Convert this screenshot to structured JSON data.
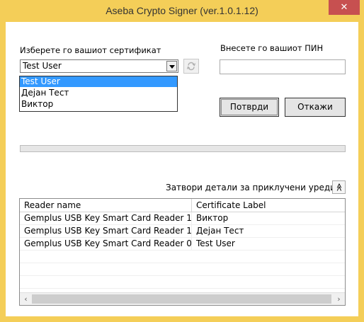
{
  "window": {
    "title": "Aseba Crypto Signer (ver.1.0.1.12)",
    "close_glyph": "✕"
  },
  "certificate": {
    "label": "Изберете го вашиот сертификат",
    "selected": "Test User",
    "options": [
      "Test User",
      "Дејан Тест",
      "Виктор"
    ]
  },
  "pin": {
    "label": "Внесете го вашиот ПИН",
    "value": ""
  },
  "buttons": {
    "confirm": "Потврди",
    "cancel": "Откажи"
  },
  "progress": {
    "value": 0
  },
  "devices": {
    "toggle_label": "Затвори детали за приклучени уреди",
    "toggle_glyph": "≪",
    "columns": [
      "Reader name",
      "Certificate Label"
    ],
    "rows": [
      [
        "Gemplus USB Key Smart Card Reader 1",
        "Виктор"
      ],
      [
        "Gemplus USB Key Smart Card Reader 1",
        "Дејан Тест"
      ],
      [
        "Gemplus USB Key Smart Card Reader 0",
        "Test User"
      ]
    ],
    "scroll_left": "‹",
    "scroll_right": "›"
  },
  "icons": {
    "close": "close-icon",
    "dropdown": "chevron-down-icon",
    "refresh": "refresh-icon",
    "collapse": "double-chevron-up-icon"
  },
  "colors": {
    "titlebar": "#f4ce58",
    "close": "#c75050",
    "selection": "#3399ff"
  }
}
